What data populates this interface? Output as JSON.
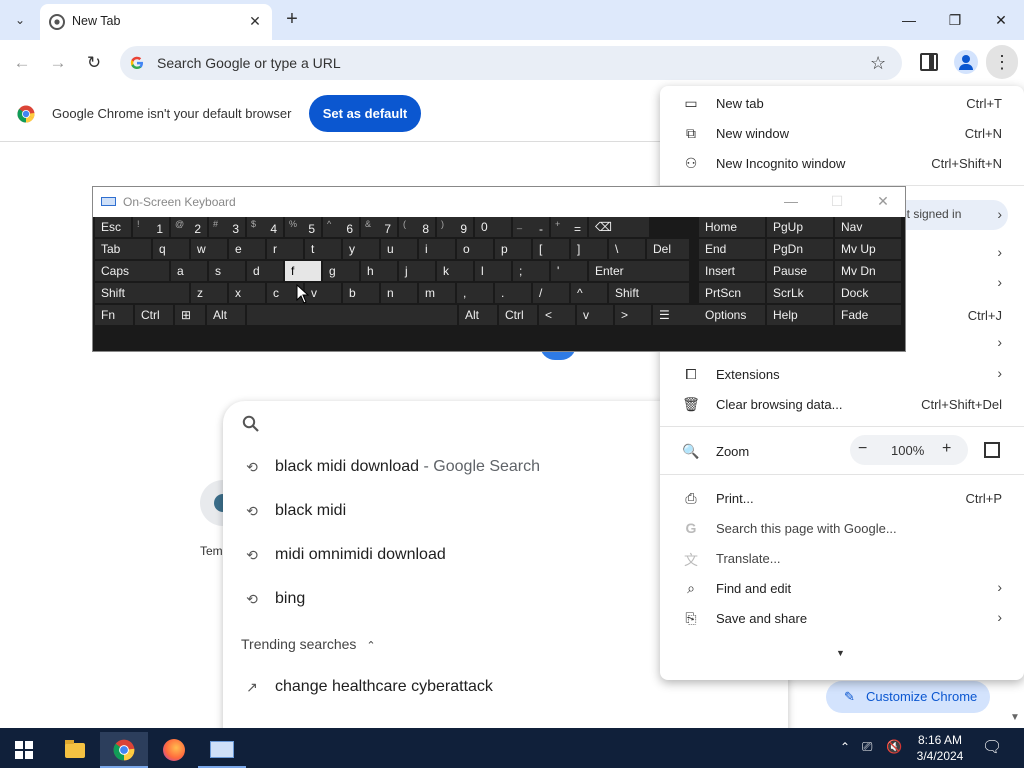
{
  "browser": {
    "tab_title": "New Tab",
    "omnibox_placeholder": "Search Google or type a URL"
  },
  "infobar": {
    "message": "Google Chrome isn't your default browser",
    "button": "Set as default"
  },
  "page": {
    "shortcut_label": "Tem",
    "customize_button": "Customize Chrome"
  },
  "suggestions": {
    "items": [
      {
        "text": "black midi download",
        "suffix": " - Google Search"
      },
      {
        "text": "black midi",
        "suffix": ""
      },
      {
        "text": "midi omnimidi download",
        "suffix": ""
      },
      {
        "text": "bing",
        "suffix": ""
      }
    ],
    "trending_header": "Trending searches",
    "trending": [
      "change healthcare cyberattack"
    ]
  },
  "menu": {
    "new_tab": {
      "label": "New tab",
      "shortcut": "Ctrl+T"
    },
    "new_window": {
      "label": "New window",
      "shortcut": "Ctrl+N"
    },
    "new_incognito": {
      "label": "New Incognito window",
      "shortcut": "Ctrl+Shift+N"
    },
    "signin": "ot signed in",
    "downloads_shortcut": "Ctrl+J",
    "extensions": "Extensions",
    "clear": {
      "label": "Clear browsing data...",
      "shortcut": "Ctrl+Shift+Del"
    },
    "zoom": {
      "label": "Zoom",
      "value": "100%",
      "minus": "−",
      "plus": "+"
    },
    "print": {
      "label": "Print...",
      "shortcut": "Ctrl+P"
    },
    "search_page": "Search this page with Google...",
    "translate": "Translate...",
    "find_edit": "Find and edit",
    "save_share": "Save and share"
  },
  "osk": {
    "title": "On-Screen Keyboard",
    "row1": [
      "Esc",
      "1",
      "2",
      "3",
      "4",
      "5",
      "6",
      "7",
      "8",
      "9",
      "0",
      "-",
      "=",
      "⌫"
    ],
    "row1_sub": [
      "",
      "!",
      "@",
      "#",
      "$",
      "%",
      "^",
      "&",
      "(",
      ")",
      "",
      "_",
      "+",
      ""
    ],
    "row2": [
      "Tab",
      "q",
      "w",
      "e",
      "r",
      "t",
      "y",
      "u",
      "i",
      "o",
      "p",
      "[",
      "]",
      "\\",
      "Del"
    ],
    "row3": [
      "Caps",
      "a",
      "s",
      "d",
      "f",
      "g",
      "h",
      "j",
      "k",
      "l",
      ";",
      "'",
      "Enter"
    ],
    "row4": [
      "Shift",
      "z",
      "x",
      "c",
      "v",
      "b",
      "n",
      "m",
      ",",
      ".",
      "/",
      "^",
      "Shift"
    ],
    "row5": [
      "Fn",
      "Ctrl",
      "⊞",
      "Alt",
      "",
      "Alt",
      "Ctrl",
      "<",
      "v",
      ">",
      "☰"
    ],
    "nav": [
      [
        "Home",
        "PgUp",
        "Nav"
      ],
      [
        "End",
        "PgDn",
        "Mv Up"
      ],
      [
        "Insert",
        "Pause",
        "Mv Dn"
      ],
      [
        "PrtScn",
        "ScrLk",
        "Dock"
      ],
      [
        "Options",
        "Help",
        "Fade"
      ]
    ]
  },
  "taskbar": {
    "time": "8:16 AM",
    "date": "3/4/2024"
  }
}
